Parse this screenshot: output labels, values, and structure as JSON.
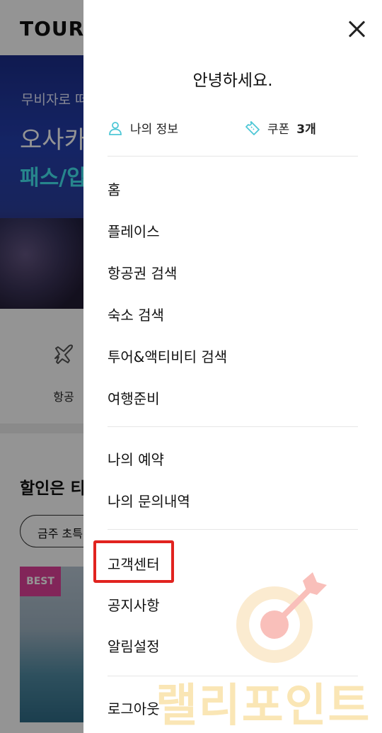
{
  "background": {
    "logo": "TOURV",
    "hero": {
      "subtitle": "무비자로 떠",
      "title": "오사카",
      "title2": "패스/입"
    },
    "category": {
      "label": "항공",
      "icon": "airplane-icon"
    },
    "sale_title": "할인은 티",
    "chip": "금주 초특가",
    "card_badge": "BEST"
  },
  "drawer": {
    "greeting": "안녕하세요.",
    "my_info": {
      "label": "나의 정보",
      "icon": "person-icon"
    },
    "coupon": {
      "label": "쿠폰",
      "count": "3개",
      "icon": "ticket-icon"
    },
    "menu_primary": [
      "홈",
      "플레이스",
      "항공권 검색",
      "숙소 검색",
      "투어&액티비티 검색",
      "여행준비"
    ],
    "menu_mine": [
      "나의 예약",
      "나의 문의내역"
    ],
    "menu_support": [
      "고객센터",
      "공지사항",
      "알림설정"
    ],
    "logout": "로그아웃",
    "accent_color": "#4ec7d6",
    "highlight_color": "#e1231f"
  },
  "watermark": {
    "text": "랠리포인트",
    "icon": "target-arrow-icon"
  }
}
